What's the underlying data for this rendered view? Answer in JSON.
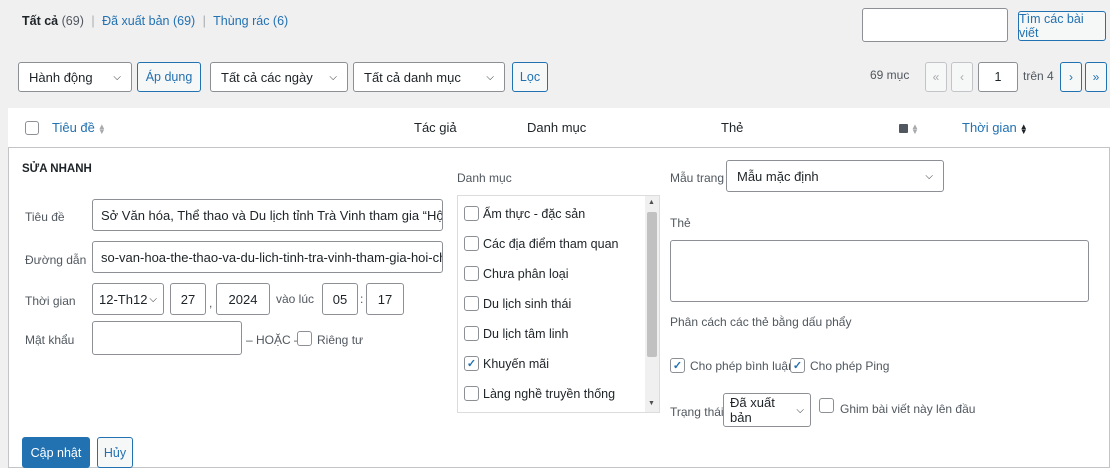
{
  "views": {
    "all": "Tất cả",
    "all_count": "(69)",
    "published": "Đã xuất bản (69)",
    "trash": "Thùng rác (6)",
    "sep": "|"
  },
  "search": {
    "value": "",
    "button": "Tìm các bài viết"
  },
  "filters": {
    "bulk_action": "Hành động",
    "apply": "Áp dụng",
    "dates": "Tất cả các ngày",
    "categories": "Tất cả danh mục",
    "filter": "Lọc"
  },
  "pagination": {
    "count": "69 mục",
    "first": "«",
    "prev": "‹",
    "current": "1",
    "of": "trên 4",
    "next": "›",
    "last": "»"
  },
  "columns": {
    "title": "Tiêu đề",
    "author": "Tác giả",
    "category": "Danh mục",
    "tags": "Thẻ",
    "date": "Thời gian"
  },
  "quick_edit": {
    "heading": "SỬA NHANH",
    "title_label": "Tiêu đề",
    "title_value": "Sở Văn hóa, Thể thao và Du lịch tỉnh Trà Vinh tham gia “Hội chợ Th",
    "slug_label": "Đường dẫn",
    "slug_value": "so-van-hoa-the-thao-va-du-lich-tinh-tra-vinh-tham-gia-hoi-cho-tl",
    "date_label": "Thời gian",
    "month": "12-Th12",
    "day": "27",
    "comma": ",",
    "year": "2024",
    "at": "vào lúc",
    "hour": "05",
    "colon": ":",
    "minute": "17",
    "password_label": "Mật khẩu",
    "password_value": "",
    "or": "– HOẶC –",
    "private": "Riêng tư",
    "categories_label": "Danh mục",
    "categories": [
      {
        "label": "Ẩm thực - đặc sản",
        "checked": false
      },
      {
        "label": "Các địa điểm tham quan",
        "checked": false
      },
      {
        "label": "Chưa phân loại",
        "checked": false
      },
      {
        "label": "Du lịch sinh thái",
        "checked": false
      },
      {
        "label": "Du lịch tâm linh",
        "checked": false
      },
      {
        "label": "Khuyến mãi",
        "checked": true
      },
      {
        "label": "Làng nghề truyền thống",
        "checked": false
      }
    ],
    "template_label": "Mẫu trang",
    "template_value": "Mẫu mặc định",
    "tags_label": "Thẻ",
    "tags_hint": "Phân cách các thẻ bằng dấu phẩy",
    "allow_comments": "Cho phép bình luận",
    "allow_pings": "Cho phép Ping",
    "status_label": "Trạng thái",
    "status_value": "Đã xuất bản",
    "sticky": "Ghim bài viết này lên đầu",
    "update": "Cập nhật",
    "cancel": "Hủy"
  },
  "colors": {
    "accent": "#2271b1",
    "border": "#8c8f94",
    "background": "#f0f0f1"
  }
}
